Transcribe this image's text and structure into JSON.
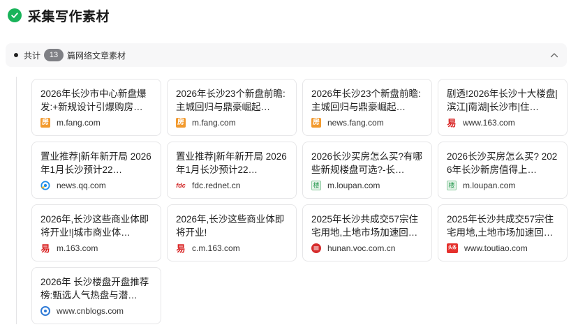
{
  "header": {
    "title": "采集写作素材"
  },
  "summary": {
    "prefix": "共计",
    "count": "13",
    "suffix": "篇网络文章素材"
  },
  "cards": [
    {
      "title": "2026年长沙市中心新盘爆发:+新规设计引爆购房…",
      "source": "m.fang.com",
      "icon": "fang-icon"
    },
    {
      "title": "2026年长沙23个新盘前瞻:主城回归与鼎豪崛起…",
      "source": "m.fang.com",
      "icon": "fang-icon"
    },
    {
      "title": "2026年长沙23个新盘前瞻:主城回归与鼎豪崛起…",
      "source": "news.fang.com",
      "icon": "fang-icon"
    },
    {
      "title": "剧透!2026年长沙十大楼盘|滨江|南湖|长沙市|住…",
      "source": "www.163.com",
      "icon": "netease-icon"
    },
    {
      "title": "置业推荐|新年新开局 2026年1月长沙预计22…",
      "source": "news.qq.com",
      "icon": "tencent-news-icon"
    },
    {
      "title": "置业推荐|新年新开局 2026年1月长沙预计22…",
      "source": "fdc.rednet.cn",
      "icon": "rednet-icon"
    },
    {
      "title": "2026长沙买房怎么买?有哪些新规楼盘可选?-长…",
      "source": "m.loupan.com",
      "icon": "loupan-icon"
    },
    {
      "title": "2026长沙买房怎么买? 2026年长沙新房值得上…",
      "source": "m.loupan.com",
      "icon": "loupan-icon"
    },
    {
      "title": "2026年,长沙这些商业体即将开业!|城市商业体…",
      "source": "m.163.com",
      "icon": "netease-icon"
    },
    {
      "title": "2026年,长沙这些商业体即将开业!",
      "source": "c.m.163.com",
      "icon": "netease-icon"
    },
    {
      "title": "2025年长沙共成交57宗住宅用地,土地市场加速回…",
      "source": "hunan.voc.com.cn",
      "icon": "voc-icon"
    },
    {
      "title": "2025年长沙共成交57宗住宅用地,土地市场加速回…",
      "source": "www.toutiao.com",
      "icon": "toutiao-icon"
    },
    {
      "title": "2026年 长沙楼盘开盘推荐榜:甄选人气热盘与潜…",
      "source": "www.cnblogs.com",
      "icon": "cnblogs-icon"
    }
  ],
  "icons": {
    "fang-icon": "房",
    "netease-icon": "易",
    "rednet-icon": "fdc",
    "loupan-icon": "楼",
    "toutiao-icon": "头条"
  },
  "colors": {
    "accent_green": "#19b35a",
    "badge_gray": "#7f8085"
  }
}
